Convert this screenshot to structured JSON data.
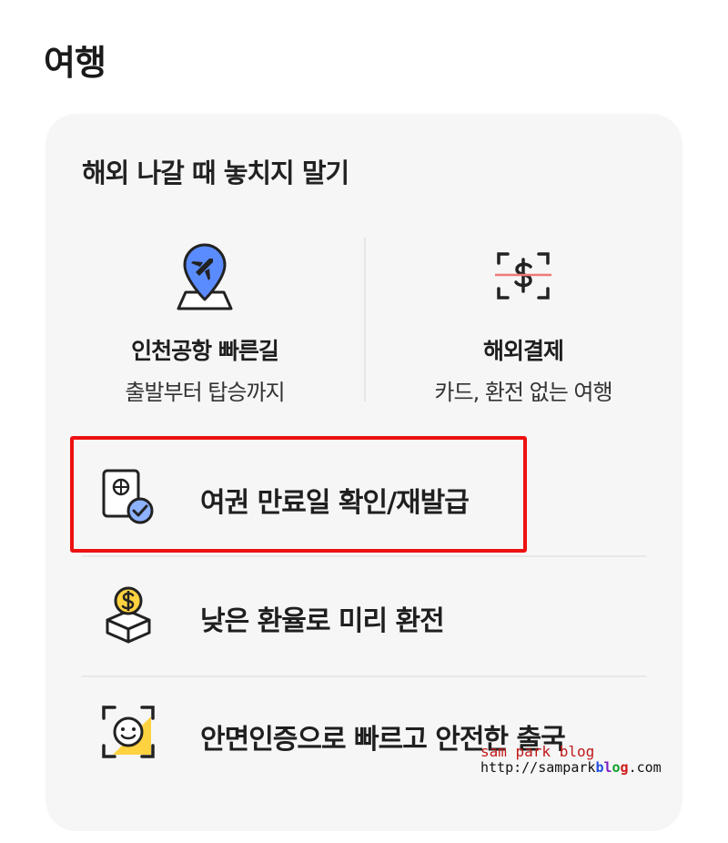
{
  "section": {
    "title": "여행"
  },
  "card": {
    "title": "해외 나갈 때 놓치지 말기",
    "quick_items": [
      {
        "icon": "airport-map-pin-icon",
        "title": "인천공항 빠른길",
        "subtitle": "출발부터 탑승까지"
      },
      {
        "icon": "dollar-scan-icon",
        "title": "해외결제",
        "subtitle": "카드, 환전 없는 여행"
      }
    ],
    "list_items": [
      {
        "icon": "passport-check-icon",
        "label": "여권 만료일 확인/재발급"
      },
      {
        "icon": "coin-box-icon",
        "label": "낮은 환율로 미리 환전"
      },
      {
        "icon": "face-scan-icon",
        "label": "안면인증으로 빠르고 안전한 출국"
      }
    ]
  },
  "watermark": {
    "line1": "sam park blog",
    "line2_prefix": "http://sampark",
    "line2_b": "b",
    "line2_l": "l",
    "line2_o": "o",
    "line2_g": "g",
    "line2_suffix": ".com"
  },
  "colors": {
    "accent_blue": "#5b8cff",
    "accent_yellow": "#ffd23f",
    "highlight_red": "#ee1111",
    "card_bg": "#f6f6f6"
  }
}
